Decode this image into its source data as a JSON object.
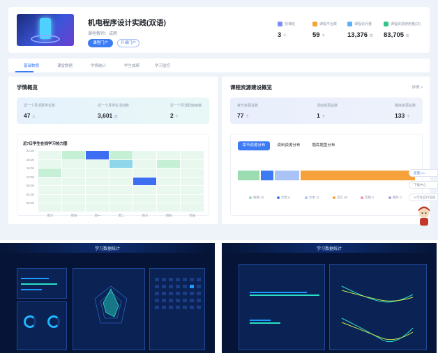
{
  "header": {
    "course_title": "机电程序设计实践(双语)",
    "teacher_text": "课程教师：成雨",
    "btn_primary": "课程门户",
    "btn_secondary": "开课门户"
  },
  "stats": [
    {
      "label": "授课班",
      "value": "3",
      "unit": "个",
      "color": "#7d8cf7"
    },
    {
      "label": "课程平台数",
      "value": "59",
      "unit": "个",
      "color": "#f6a23b"
    },
    {
      "label": "课程访问量",
      "value": "13,376",
      "unit": "次",
      "color": "#5ab0f7"
    },
    {
      "label": "课程资源使用量(次)",
      "value": "83,705",
      "unit": "次",
      "color": "#34c38f"
    }
  ],
  "tabs": [
    "基础数据",
    "课堂数据",
    "学情统计",
    "学生成绩",
    "学习监控"
  ],
  "learning": {
    "title": "学情概览",
    "summary": [
      {
        "label": "近一个月活跃学生数",
        "value": "47",
        "unit": "人"
      },
      {
        "label": "近一个月学生活动数",
        "value": "3,601",
        "unit": "次"
      },
      {
        "label": "近一个月活跃班级数",
        "value": "2",
        "unit": "个"
      }
    ],
    "heatmap_title": "近7日学生在线学习热力图"
  },
  "resources": {
    "title": "课程资源建设概览",
    "more": "详情 >",
    "summary": [
      {
        "label": "章节资源总数",
        "value": "77",
        "unit": "个"
      },
      {
        "label": "活动资源总数",
        "value": "1",
        "unit": "个"
      },
      {
        "label": "题库资源总数",
        "value": "133",
        "unit": "个"
      }
    ],
    "pills": [
      "章节资源分布",
      "资料资源分布",
      "题库题型分布"
    ],
    "legend": [
      {
        "label": "视频 10",
        "color": "#9bdcb0"
      },
      {
        "label": "文档 6",
        "color": "#3d7bf5"
      },
      {
        "label": "文本 11",
        "color": "#a9c3f7"
      },
      {
        "label": "其它 50",
        "color": "#f6a23b"
      },
      {
        "label": "音频 0",
        "color": "#f48fb1"
      },
      {
        "label": "图片 0",
        "color": "#b39ddb"
      }
    ]
  },
  "side_tools": [
    "反馈 ▷▷",
    "下载中心",
    "AI学生自行答疑"
  ],
  "dark_left": {
    "title": "学习数据统计"
  },
  "dark_right": {
    "title": "学习数据统计"
  },
  "chart_data": {
    "type": "heatmap",
    "title": "近7日学生在线学习热力图",
    "y_labels": [
      "24:00",
      "20:00",
      "16:00",
      "12:00",
      "08:00",
      "04:00",
      "00:00"
    ],
    "x_labels": [
      "周六",
      "周日",
      "周一",
      "周二",
      "周三",
      "周四",
      "周五"
    ],
    "values": [
      [
        1,
        2,
        4,
        2,
        1,
        1,
        1
      ],
      [
        1,
        1,
        1,
        3,
        1,
        2,
        1
      ],
      [
        2,
        1,
        1,
        1,
        1,
        1,
        1
      ],
      [
        1,
        1,
        1,
        1,
        4,
        1,
        1
      ],
      [
        1,
        1,
        1,
        1,
        1,
        1,
        1
      ],
      [
        1,
        1,
        1,
        1,
        1,
        1,
        1
      ],
      [
        1,
        1,
        1,
        1,
        1,
        1,
        1
      ]
    ],
    "bar_type": "stacked-bar",
    "bar_categories": [
      "视频",
      "文档",
      "文本",
      "其它",
      "音频",
      "图片"
    ],
    "bar_values": [
      10,
      6,
      11,
      50,
      0,
      0
    ]
  }
}
